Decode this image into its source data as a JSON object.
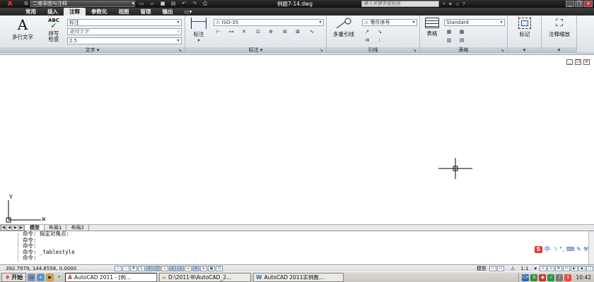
{
  "titlebar": {
    "workspace": "二维草图与注释",
    "doc_title": "例题7-14.dwg",
    "search_placeholder": "键入关键字或短语"
  },
  "tabs": [
    "常用",
    "插入",
    "注释",
    "参数化",
    "视图",
    "管理",
    "输出"
  ],
  "active_tab": "注释",
  "ribbon": {
    "text_panel": {
      "title": "文字",
      "multiline_text": "多行文字",
      "spell_check_line1": "拼写",
      "spell_check_line2": "检查",
      "abc": "ABC",
      "text_style": "标注",
      "find_text_placeholder": "查找文字",
      "text_height": "2.5"
    },
    "dimension_panel": {
      "title": "标注",
      "dimension_button": "标注",
      "dim_style": "ISO-35"
    },
    "leader_panel": {
      "title": "引线",
      "multileader": "多重引线",
      "leader_style": "零件序号"
    },
    "table_panel": {
      "title": "表格",
      "table_button": "表格",
      "table_style": "Standard"
    },
    "markup_panel": {
      "button": "标记"
    },
    "scale_panel": {
      "button": "注释缩放"
    }
  },
  "layout_tabs": [
    "模型",
    "布局1",
    "布局2"
  ],
  "command_lines": [
    "命令: 指定对角点:",
    "命令:",
    "命令:",
    "命令: _tablestyle",
    "命令:"
  ],
  "ime": {
    "s": "S",
    "zh": "中"
  },
  "status": {
    "coords": "392.7979, 144.6558, 0.0000",
    "model_label": "模型",
    "scale": "1:1"
  },
  "taskbar": {
    "start": "开始",
    "items": [
      "AutoCAD 2011 - [例...",
      "D:\\2011书\\AutoCAD_2...",
      "AutoCAD 2011实例教..."
    ],
    "clock": "10:42"
  }
}
